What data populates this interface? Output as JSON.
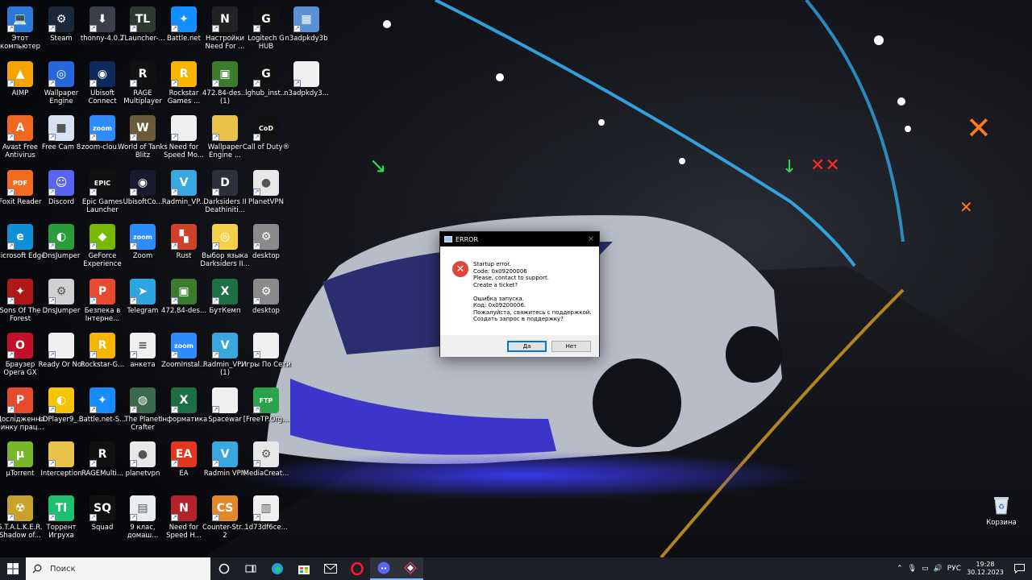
{
  "desktop": {
    "icons": [
      {
        "label": "Этот компьютер",
        "bg": "#2b79d6",
        "glyph": "💻"
      },
      {
        "label": "Steam",
        "bg": "#1b2838",
        "glyph": "⚙"
      },
      {
        "label": "thonny-4.0.2",
        "bg": "#3a3f4a",
        "glyph": "⬇"
      },
      {
        "label": "TLauncher-...",
        "bg": "#2e3a30",
        "glyph": "TL"
      },
      {
        "label": "Battle.net",
        "bg": "#148eff",
        "glyph": "✦"
      },
      {
        "label": "Настройки Need For ...",
        "bg": "#222",
        "glyph": "N"
      },
      {
        "label": "Logitech G HUB",
        "bg": "#111",
        "glyph": "G"
      },
      {
        "label": "n3adpkdy3b",
        "bg": "#5b8fd6",
        "glyph": "▦"
      },
      {
        "label": "AIMP",
        "bg": "#f5a300",
        "glyph": "▲"
      },
      {
        "label": "Wallpaper Engine",
        "bg": "#2667d9",
        "glyph": "◎"
      },
      {
        "label": "Ubisoft Connect",
        "bg": "#0e2a5a",
        "glyph": "◉"
      },
      {
        "label": "RAGE Multiplayer",
        "bg": "#111",
        "glyph": "R"
      },
      {
        "label": "Rockstar Games ...",
        "bg": "#f7b500",
        "glyph": "R"
      },
      {
        "label": "472.84-des... (1)",
        "bg": "#3c7a2c",
        "glyph": "▣"
      },
      {
        "label": "lghub_inst...",
        "bg": "#111",
        "glyph": "G"
      },
      {
        "label": "n3adpkdy3...",
        "bg": "#f0f0f0",
        "glyph": ""
      },
      {
        "label": "Avast Free Antivirus",
        "bg": "#f26722",
        "glyph": "A"
      },
      {
        "label": "Free Cam 8",
        "bg": "#d8e2ef",
        "glyph": "■"
      },
      {
        "label": "zoom-clou...",
        "bg": "#2d8cff",
        "glyph": "zoom"
      },
      {
        "label": "World of Tanks Blitz",
        "bg": "#6b5a3a",
        "glyph": "W"
      },
      {
        "label": "Need for Speed Mo...",
        "bg": "#f0f0f0",
        "glyph": ""
      },
      {
        "label": "Wallpaper Engine ...",
        "bg": "#e9c24a",
        "glyph": ""
      },
      {
        "label": "Call of Duty®",
        "bg": "#111",
        "glyph": "CoD"
      },
      {
        "label": "Foxit Reader",
        "bg": "#f26b21",
        "glyph": "PDF"
      },
      {
        "label": "Discord",
        "bg": "#5865f2",
        "glyph": "☺"
      },
      {
        "label": "Epic Games Launcher",
        "bg": "#111",
        "glyph": "EPIC"
      },
      {
        "label": "UbisoftCo...",
        "bg": "#1a1a2e",
        "glyph": "◉"
      },
      {
        "label": "Radmin_VP...",
        "bg": "#39a7e0",
        "glyph": "V"
      },
      {
        "label": "Darksiders II Deathiniti...",
        "bg": "#2d2f3a",
        "glyph": "D"
      },
      {
        "label": "PlanetVPN",
        "bg": "#e8e8e8",
        "glyph": "●"
      },
      {
        "label": "Microsoft Edge",
        "bg": "#0f8fd6",
        "glyph": "e"
      },
      {
        "label": "DnsJumper",
        "bg": "#2a9c3c",
        "glyph": "◐"
      },
      {
        "label": "GeForce Experience",
        "bg": "#76b900",
        "glyph": "◆"
      },
      {
        "label": "Zoom",
        "bg": "#2d8cff",
        "glyph": "zoom"
      },
      {
        "label": "Rust",
        "bg": "#cd412b",
        "glyph": "▚"
      },
      {
        "label": "Выбор языка Darksiders II...",
        "bg": "#f3d24a",
        "glyph": "◎"
      },
      {
        "label": "desktop",
        "bg": "#8a8a8a",
        "glyph": "⚙"
      },
      {
        "label": "Sons Of The Forest",
        "bg": "#b01818",
        "glyph": "✦"
      },
      {
        "label": "DnsJumper",
        "bg": "#d0d0d0",
        "glyph": "⚙"
      },
      {
        "label": "Безпека в Інтерне...",
        "bg": "#e84a2e",
        "glyph": "P"
      },
      {
        "label": "Telegram",
        "bg": "#2ca5e0",
        "glyph": "➤"
      },
      {
        "label": "472.84-des...",
        "bg": "#3c7a2c",
        "glyph": "▣"
      },
      {
        "label": "БутКемп",
        "bg": "#1d7044",
        "glyph": "X"
      },
      {
        "label": "desktop",
        "bg": "#8a8a8a",
        "glyph": "⚙"
      },
      {
        "label": "Браузер Opera GX",
        "bg": "#c0102a",
        "glyph": "O"
      },
      {
        "label": "Ready Or Not",
        "bg": "#f0f0f0",
        "glyph": ""
      },
      {
        "label": "Rockstar-G...",
        "bg": "#f7b500",
        "glyph": "R"
      },
      {
        "label": "анкета",
        "bg": "#f0f0f0",
        "glyph": "≡"
      },
      {
        "label": "ZoomInstal...",
        "bg": "#2d8cff",
        "glyph": "zoom"
      },
      {
        "label": "Radmin_VP... (1)",
        "bg": "#39a7e0",
        "glyph": "V"
      },
      {
        "label": "Игры По Сети",
        "bg": "#f0f0f0",
        "glyph": ""
      },
      {
        "label": "Дослідження ринку прац...",
        "bg": "#e84a2e",
        "glyph": "P"
      },
      {
        "label": "LDPlayer9_...",
        "bg": "#f5c400",
        "glyph": "◐"
      },
      {
        "label": "Battle.net-S...",
        "bg": "#148eff",
        "glyph": "✦"
      },
      {
        "label": "The Planet Crafter",
        "bg": "#3b6a4a",
        "glyph": "◍"
      },
      {
        "label": "Інформатика",
        "bg": "#1d7044",
        "glyph": "X"
      },
      {
        "label": "Spacewar",
        "bg": "#f0f0f0",
        "glyph": ""
      },
      {
        "label": "[FreeTP.Org...",
        "bg": "#2aa34a",
        "glyph": "FTP"
      },
      {
        "label": "µTorrent",
        "bg": "#78b72a",
        "glyph": "µ"
      },
      {
        "label": "Interception",
        "bg": "#e9c24a",
        "glyph": ""
      },
      {
        "label": "RAGEMulti...",
        "bg": "#111",
        "glyph": "R"
      },
      {
        "label": "planetvpn",
        "bg": "#e8e8e8",
        "glyph": "●"
      },
      {
        "label": "EA",
        "bg": "#e2361e",
        "glyph": "EA"
      },
      {
        "label": "Radmin VPN",
        "bg": "#39a7e0",
        "glyph": "V"
      },
      {
        "label": "MediaCreat...",
        "bg": "#e8e8e8",
        "glyph": "⚙"
      },
      {
        "label": "S.T.A.L.K.E.R. Shadow of...",
        "bg": "#c7a12a",
        "glyph": "☢"
      },
      {
        "label": "Торрент Игруха",
        "bg": "#1dbf73",
        "glyph": "TI"
      },
      {
        "label": "Squad",
        "bg": "#111",
        "glyph": "SQ"
      },
      {
        "label": "9 клас, домаш...",
        "bg": "#e8eef0",
        "glyph": "▤"
      },
      {
        "label": "Need for Speed H...",
        "bg": "#b2242a",
        "glyph": "N"
      },
      {
        "label": "Counter-Str... 2",
        "bg": "#e2882b",
        "glyph": "CS"
      },
      {
        "label": "1d73df6ce...",
        "bg": "#f0f0f0",
        "glyph": "▥"
      }
    ],
    "recycle_bin": {
      "label": "Корзина"
    }
  },
  "dialog": {
    "title": "ERROR",
    "lines": [
      "Startup error.",
      "Code: 0x09200006",
      "Please, contact to support.",
      "Create a ticket?",
      "",
      "Ошибка запуска.",
      "Код: 0x09200006.",
      "Пожалуйста, свяжитесь с поддержкой.",
      "Создать запрос в поддержку?"
    ],
    "yes_label": "Да",
    "no_label": "Нет"
  },
  "taskbar": {
    "search_placeholder": "Поиск",
    "language": "РУС",
    "time": "19:28",
    "date": "30.12.2023"
  }
}
